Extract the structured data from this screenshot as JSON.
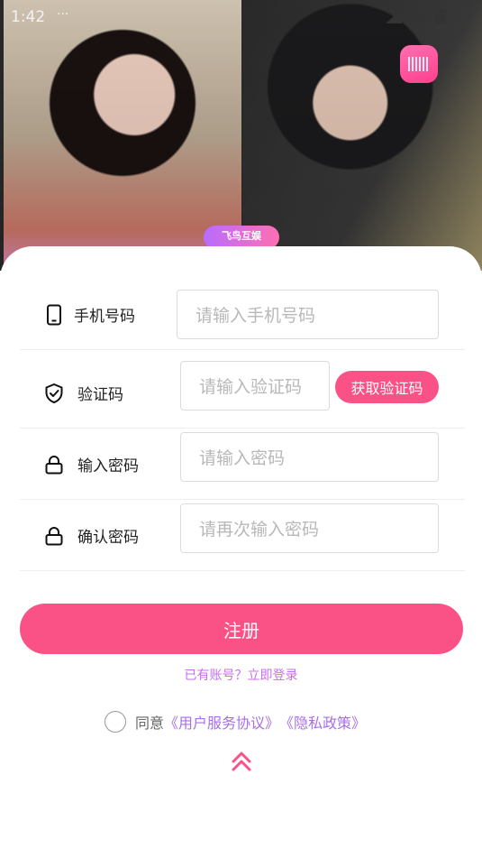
{
  "status_bar": {
    "time": "1:42",
    "dots": "···"
  },
  "hero": {
    "tag": "飞鸟互娱"
  },
  "form": {
    "phone": {
      "label": "手机号码",
      "placeholder": "请输入手机号码"
    },
    "code": {
      "label": "验证码",
      "placeholder": "请输入验证码",
      "button": "获取验证码"
    },
    "password": {
      "label": "输入密码",
      "placeholder": "请输入密码"
    },
    "confirm": {
      "label": "确认密码",
      "placeholder": "请再次输入密码"
    }
  },
  "actions": {
    "register": "注册",
    "login_link": "已有账号？立即登录"
  },
  "agreement": {
    "prefix": "同意",
    "terms": "《用户服务协议》",
    "privacy": "《隐私政策》"
  },
  "colors": {
    "accent": "#fa5286",
    "link": "#c86cf0"
  }
}
